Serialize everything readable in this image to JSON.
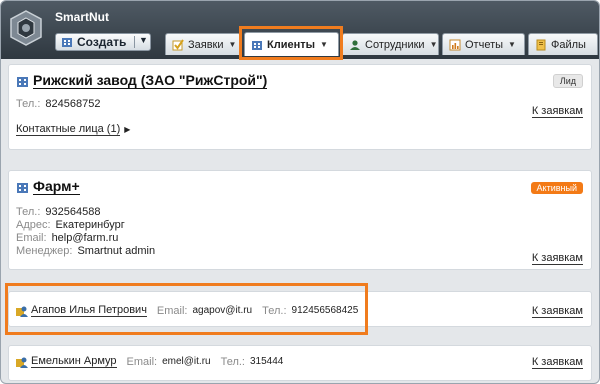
{
  "header": {
    "app_title": "SmartNut",
    "create_label": "Создать",
    "tabs": [
      {
        "label": "Заявки"
      },
      {
        "label": "Клиенты"
      },
      {
        "label": "Сотрудники"
      },
      {
        "label": "Отчеты"
      },
      {
        "label": "Файлы"
      }
    ]
  },
  "cards": [
    {
      "name": "Рижский завод (ЗАО \"РижСтрой\")",
      "badge": "Лид",
      "phone_label": "Тел.:",
      "phone": "824568752",
      "contacts_label": "Контактные лица (1)",
      "link_label": "К заявкам"
    },
    {
      "name": "Фарм+",
      "badge": "Активный",
      "phone_label": "Тел.:",
      "phone": "932564588",
      "address_label": "Адрес:",
      "address": "Екатеринбург",
      "email_label": "Email:",
      "email": "help@farm.ru",
      "manager_label": "Менеджер:",
      "manager": "Smartnut admin",
      "link_label": "К заявкам"
    }
  ],
  "people": [
    {
      "name": "Агапов Илья Петрович",
      "email_label": "Email:",
      "email": "agapov@it.ru",
      "phone_label": "Тел.:",
      "phone": "912456568425",
      "link_label": "К заявкам"
    },
    {
      "name": "Емелькин Армур",
      "email_label": "Email:",
      "email": "emel@it.ru",
      "phone_label": "Тел.:",
      "phone": "315444",
      "link_label": "К заявкам"
    }
  ],
  "colors": {
    "highlight": "#f07c1e",
    "badge_active": "#f37a16",
    "header_bg": "#3a444d"
  }
}
